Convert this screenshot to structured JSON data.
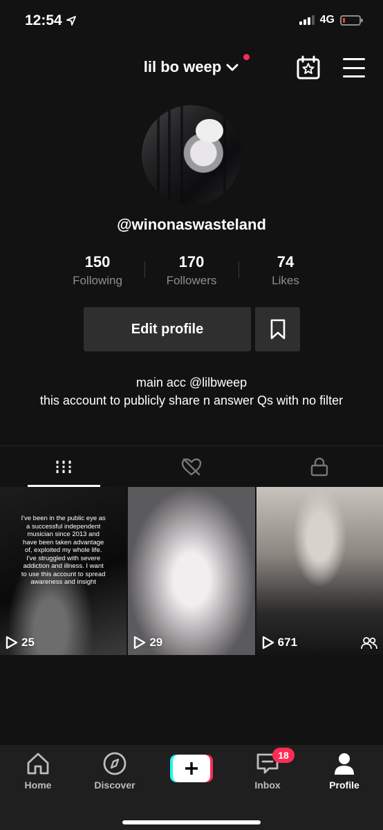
{
  "status_bar": {
    "time": "12:54",
    "network": "4G",
    "battery_level": 0.15,
    "battery_color": "#ff3b30"
  },
  "header": {
    "username": "lil bo weep",
    "notification_dot_color": "#fe2c55",
    "calendar_icon": "calendar-star-icon",
    "menu_icon": "hamburger-menu-icon"
  },
  "profile": {
    "handle": "@winonaswasteland",
    "stats": [
      {
        "value": "150",
        "label": "Following"
      },
      {
        "value": "170",
        "label": "Followers"
      },
      {
        "value": "74",
        "label": "Likes"
      }
    ],
    "edit_label": "Edit profile",
    "bio_line1": "main acc @lilbweep",
    "bio_line2": "this account to publicly share n answer Qs with no filter"
  },
  "tabs": [
    {
      "icon": "grid-icon",
      "active": true
    },
    {
      "icon": "liked-videos-icon",
      "active": false
    },
    {
      "icon": "lock-icon",
      "active": false
    }
  ],
  "videos": [
    {
      "views": "25",
      "caption": "I've been in the public eye as a successful independent musician since 2013 and have been taken advantage of, exploited my whole life. I've struggled with severe addiction and illness. I want to use this account to spread awareness and insight"
    },
    {
      "views": "29"
    },
    {
      "views": "671",
      "icon": "friends-icon"
    }
  ],
  "nav": {
    "home": "Home",
    "discover": "Discover",
    "inbox": "Inbox",
    "inbox_badge": "18",
    "profile": "Profile",
    "accent_colors": [
      "#25f4ee",
      "#fe2c55"
    ]
  }
}
